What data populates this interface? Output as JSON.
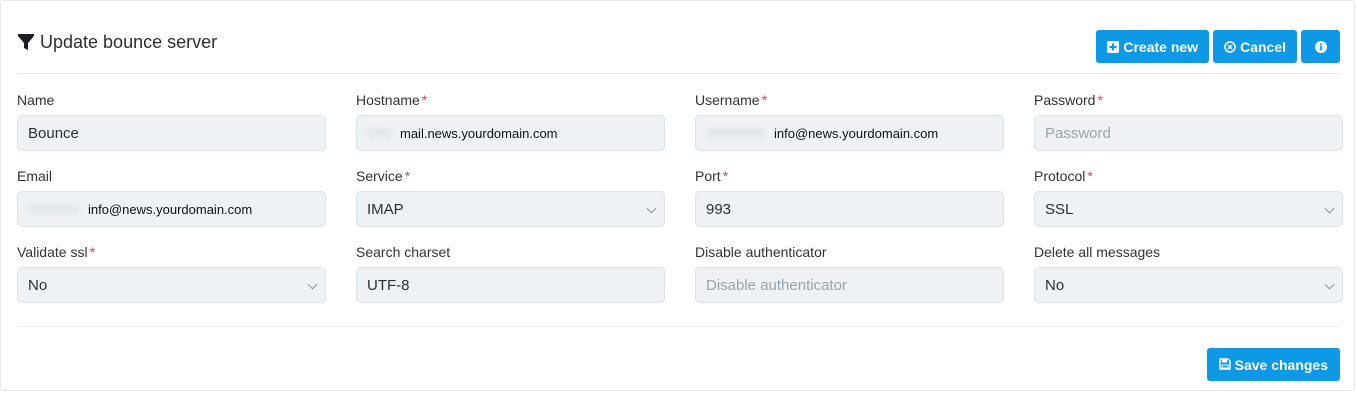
{
  "header": {
    "title": "Update bounce server",
    "create_label": "Create new",
    "cancel_label": "Cancel"
  },
  "fields": {
    "name": {
      "label": "Name",
      "value": "Bounce",
      "required": false
    },
    "hostname": {
      "label": "Hostname",
      "value": "mail.news.yourdomain.com",
      "required": true
    },
    "username": {
      "label": "Username",
      "value": "info@news.yourdomain.com",
      "required": true
    },
    "password": {
      "label": "Password",
      "placeholder": "Password",
      "required": true
    },
    "email": {
      "label": "Email",
      "value": "info@news.yourdomain.com",
      "required": false
    },
    "service": {
      "label": "Service",
      "value": "IMAP",
      "required": true
    },
    "port": {
      "label": "Port",
      "value": "993",
      "required": true
    },
    "protocol": {
      "label": "Protocol",
      "value": "SSL",
      "required": true
    },
    "validate_ssl": {
      "label": "Validate ssl",
      "value": "No",
      "required": true
    },
    "search_charset": {
      "label": "Search charset",
      "value": "UTF-8",
      "required": false
    },
    "disable_authenticator": {
      "label": "Disable authenticator",
      "placeholder": "Disable authenticator",
      "required": false
    },
    "delete_all_messages": {
      "label": "Delete all messages",
      "value": "No",
      "required": false
    }
  },
  "required_marker": "*",
  "footer": {
    "save_label": "Save changes"
  },
  "colors": {
    "primary": "#0d99e6",
    "required": "#e2483d",
    "input_bg": "#eef2f5"
  }
}
